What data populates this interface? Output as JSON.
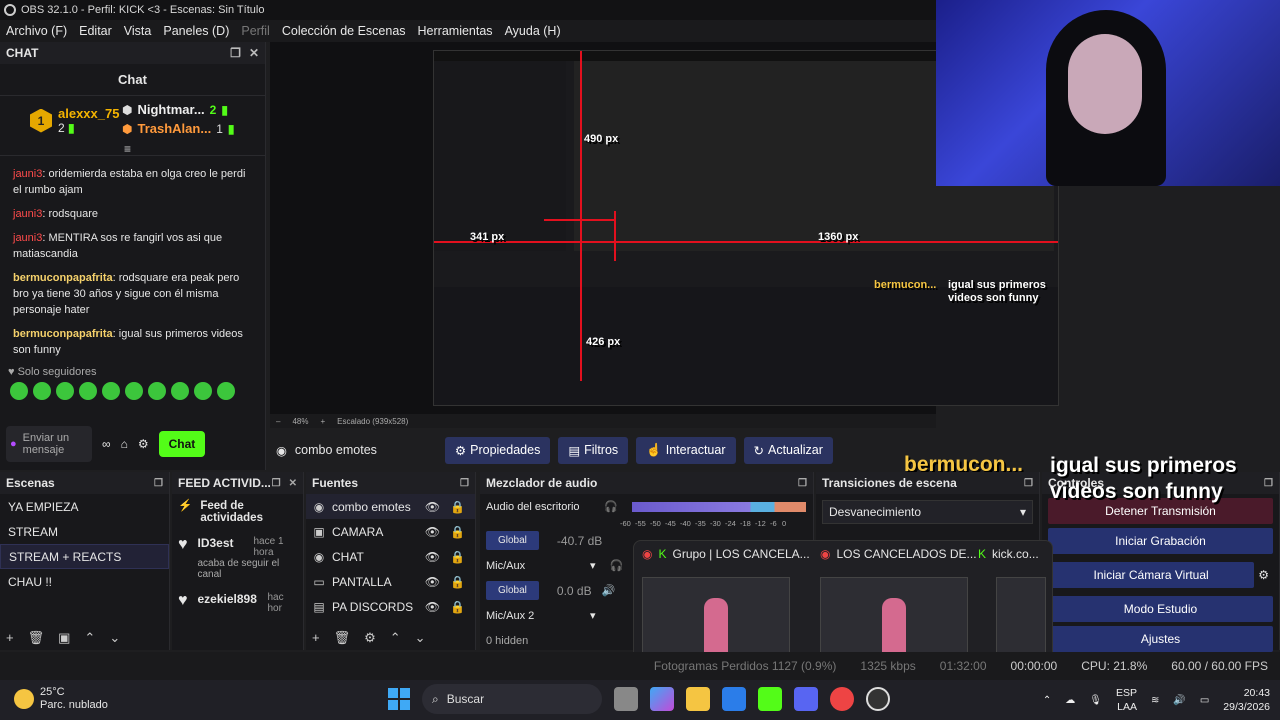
{
  "window": {
    "title": "OBS 32.1.0 - Perfil: KICK <3 - Escenas: Sin Título"
  },
  "menu": [
    {
      "label": "Archivo (F)",
      "enabled": true
    },
    {
      "label": "Editar",
      "enabled": true
    },
    {
      "label": "Vista",
      "enabled": true
    },
    {
      "label": "Paneles (D)",
      "enabled": true
    },
    {
      "label": "Perfil",
      "enabled": false
    },
    {
      "label": "Colección de Escenas",
      "enabled": true
    },
    {
      "label": "Herramientas",
      "enabled": true
    },
    {
      "label": "Ayuda (H)",
      "enabled": true
    }
  ],
  "chat": {
    "dock_title": "CHAT",
    "title": "Chat",
    "leaders": [
      {
        "rank": "1",
        "name": "alexxx_75",
        "count": "2"
      },
      {
        "rank": "2",
        "name": "Nightmar...",
        "count": "2"
      },
      {
        "rank": "3",
        "name": "TrashAlan...",
        "count": "1"
      }
    ],
    "messages": [
      {
        "user": "jauni3",
        "text": "oridemierda estaba en olga creo le perdi el rumbo ajam"
      },
      {
        "user": "jauni3",
        "text": "rodsquare"
      },
      {
        "user": "jauni3",
        "text": "MENTIRA sos re fangirl vos asi que matiascandia"
      },
      {
        "user": "bermuconpapafrita",
        "text": "rodsquare era peak pero bro ya tiene 30 años y sigue con él misma personaje hater"
      },
      {
        "user": "bermuconpapafrita",
        "text": "igual sus primeros videos son funny"
      }
    ],
    "followers_only": "Solo seguidores",
    "input_placeholder": "Enviar un mensaje",
    "send_label": "Chat"
  },
  "preview": {
    "zoom": "48%",
    "scale_label": "Escalado (939x528)",
    "overlay_user": "bermucon...",
    "overlay_msg_line1": "igual sus primeros",
    "overlay_msg_line2": "videos son funny",
    "measure_490": "490 px",
    "measure_341": "341 px",
    "measure_1360": "1360 px",
    "measure_426": "426 px"
  },
  "source_bar": {
    "source_name": "combo emotes",
    "buttons": [
      "Propiedades",
      "Filtros",
      "Interactuar",
      "Actualizar"
    ]
  },
  "scenes": {
    "title": "Escenas",
    "items": [
      "YA EMPIEZA",
      "STREAM",
      "STREAM + REACTS",
      "CHAU !!"
    ],
    "selected_index": 2
  },
  "feed": {
    "title": "FEED ACTIVID...",
    "header": "Feed de actividades",
    "items": [
      {
        "user": "ID3est",
        "time": "hace 1 hora",
        "action": "acaba de seguir el canal"
      },
      {
        "user": "ezekiel898",
        "time": "hac hor",
        "action": ""
      }
    ]
  },
  "sources": {
    "title": "Fuentes",
    "items": [
      "combo emotes",
      "CAMARA",
      "CHAT",
      "PANTALLA",
      "PA DISCORDS"
    ]
  },
  "mixer": {
    "title": "Mezclador de audio",
    "tracks": [
      {
        "name": "Audio del escritorio",
        "button": "Global",
        "db": "-40.7 dB"
      },
      {
        "name": "Mic/Aux",
        "button": "Global",
        "db": "0.0 dB"
      },
      {
        "name": "Mic/Aux 2",
        "button": "",
        "db": ""
      }
    ],
    "scale": [
      "-60",
      "-55",
      "-50",
      "-45",
      "-40",
      "-35",
      "-30",
      "-24",
      "-18",
      "-12",
      "-6",
      "0"
    ],
    "hidden": "0 hidden"
  },
  "transitions": {
    "title": "Transiciones de escena",
    "selected": "Desvanecimiento"
  },
  "controls": {
    "title": "Controles",
    "buttons": [
      "Detener Transmisión",
      "Iniciar Grabación",
      "Iniciar Cámara Virtual",
      "Modo Estudio",
      "Ajustes"
    ]
  },
  "taskbar_popup": {
    "tabs": [
      "Grupo | LOS CANCELA...",
      "LOS CANCELADOS DE...",
      "kick.co..."
    ]
  },
  "status": {
    "dropped": "Fotogramas Perdidos 1127 (0.9%)",
    "bitrate": "1325 kbps",
    "rec_time": "01:32:00",
    "stream_time": "00:00:00",
    "cpu": "CPU: 21.8%",
    "fps": "60.00 / 60.00 FPS"
  },
  "taskbar": {
    "temp": "25°C",
    "weather": "Parc. nublado",
    "search": "Buscar",
    "lang1": "ESP",
    "lang2": "LAA",
    "time": "20:43",
    "date": "29/3/2026"
  },
  "colors": {
    "kick_green": "#53fc18",
    "accent_blue": "#263270",
    "live_red": "#e3101e"
  }
}
